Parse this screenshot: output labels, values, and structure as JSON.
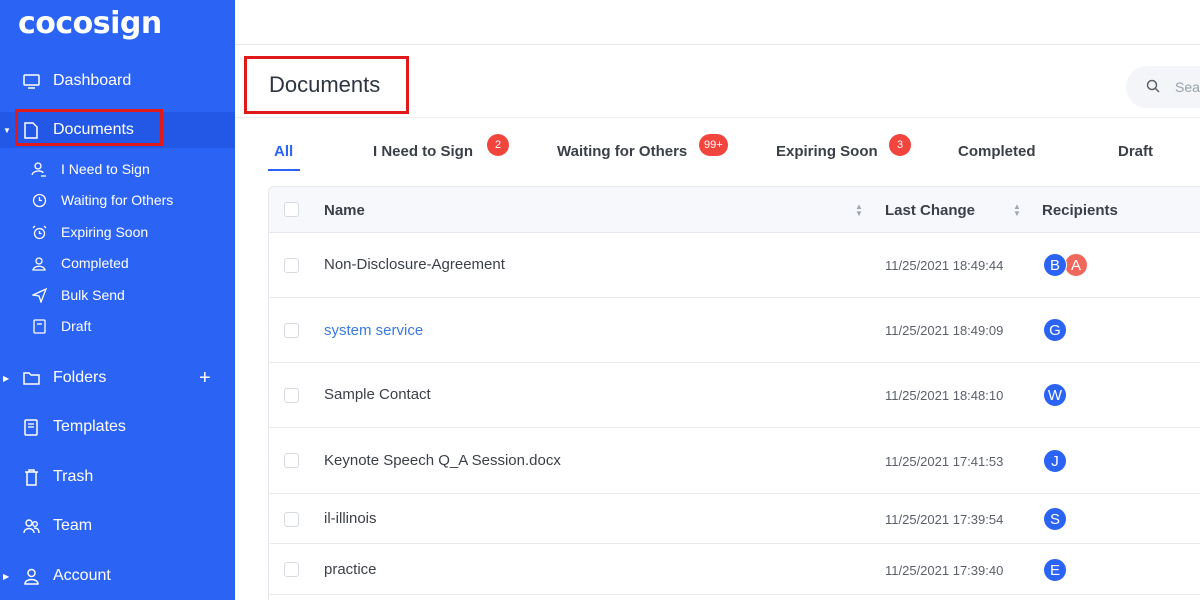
{
  "app": {
    "logo": "cocosign"
  },
  "sidebar": {
    "items": [
      {
        "label": "Dashboard"
      },
      {
        "label": "Documents"
      },
      {
        "label": "Folders"
      },
      {
        "label": "Templates"
      },
      {
        "label": "Trash"
      },
      {
        "label": "Team"
      },
      {
        "label": "Account"
      }
    ],
    "subitems": [
      {
        "label": "I Need to Sign"
      },
      {
        "label": "Waiting for Others"
      },
      {
        "label": "Expiring Soon"
      },
      {
        "label": "Completed"
      },
      {
        "label": "Bulk Send"
      },
      {
        "label": "Draft"
      }
    ],
    "add_symbol": "+"
  },
  "main": {
    "title": "Documents",
    "search_placeholder": "Sea",
    "tabs": [
      {
        "label": "All"
      },
      {
        "label": "I Need to Sign",
        "badge": "2"
      },
      {
        "label": "Waiting for Others",
        "badge": "99+"
      },
      {
        "label": "Expiring Soon",
        "badge": "3"
      },
      {
        "label": "Completed"
      },
      {
        "label": "Draft"
      }
    ],
    "table": {
      "columns": [
        "Name",
        "Last Change",
        "Recipients"
      ],
      "rows": [
        {
          "name": "Non-Disclosure-Agreement",
          "date": "11/25/2021 18:49:44",
          "recipients": [
            "B",
            "A"
          ]
        },
        {
          "name": "system service",
          "date": "11/25/2021 18:49:09",
          "recipients": [
            "G"
          ]
        },
        {
          "name": "Sample Contact",
          "date": "11/25/2021 18:48:10",
          "recipients": [
            "W"
          ]
        },
        {
          "name": "Keynote Speech Q_A Session.docx",
          "date": "11/25/2021 17:41:53",
          "recipients": [
            "J"
          ]
        },
        {
          "name": "il-illinois",
          "date": "11/25/2021 17:39:54",
          "recipients": [
            "S"
          ]
        },
        {
          "name": "practice",
          "date": "11/25/2021 17:39:40",
          "recipients": [
            "E"
          ]
        }
      ]
    }
  },
  "colors": {
    "brand": "#2b63f5",
    "badge": "#f2453d",
    "avatar_blue": "#2b63f5",
    "avatar_orange": "#f0675b",
    "highlight": "#e01a1a"
  }
}
